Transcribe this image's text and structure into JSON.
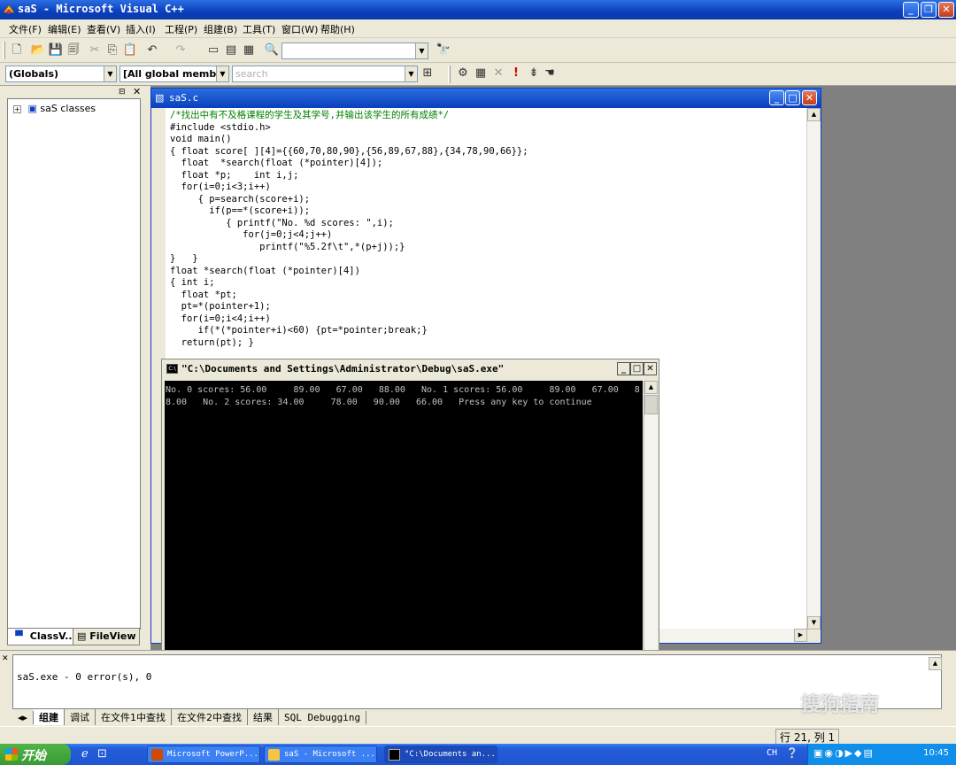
{
  "window": {
    "title": "saS - Microsoft Visual C++"
  },
  "menu": [
    "文件(F)",
    "编辑(E)",
    "查看(V)",
    "插入(I)",
    "工程(P)",
    "组建(B)",
    "工具(T)",
    "窗口(W)",
    "帮助(H)"
  ],
  "toolbar2": {
    "globals": "(Globals)",
    "members": "[All global members",
    "search_placeholder": "search"
  },
  "workspace": {
    "root": "saS classes",
    "tab_classview": "ClassV...",
    "tab_fileview": "FileView"
  },
  "editor": {
    "title": "saS.c",
    "code": "/*找出中有不及格课程的学生及其学号,并输出该学生的所有成绩*/\n#include <stdio.h>\nvoid main()\n{ float score[ ][4]={{60,70,80,90},{56,89,67,88},{34,78,90,66}};\n  float  *search(float (*pointer)[4]);\n  float *p;    int i,j;\n  for(i=0;i<3;i++)\n     { p=search(score+i);\n       if(p==*(score+i));\n          { printf(\"No. %d scores: \",i);\n             for(j=0;j<4;j++)\n                printf(\"%5.2f\\t\",*(p+j));}\n}   }\nfloat *search(float (*pointer)[4])\n{ int i;\n  float *pt;\n  pt=*(pointer+1);\n  for(i=0;i<4;i++)\n     if(*(*pointer+i)<60) {pt=*pointer;break;}\n  return(pt); }"
  },
  "console": {
    "title": "\"C:\\Documents and Settings\\Administrator\\Debug\\saS.exe\"",
    "output": "No. 0 scores: 56.00     89.00   67.00   88.00   No. 1 scores: 56.00     89.00   67.00   88.00   No. 2 scores: 34.00     78.00   90.00   66.00   Press any key to continue"
  },
  "output_panel": {
    "text": "saS.exe - 0 error(s), 0",
    "tabs": [
      "组建",
      "调试",
      "在文件1中查找",
      "在文件2中查找",
      "结果",
      "SQL Debugging"
    ]
  },
  "statusbar": {
    "position": "行 21, 列 1"
  },
  "taskbar": {
    "start": "开始",
    "tasks": [
      "Microsoft PowerP...",
      "saS - Microsoft ...",
      "\"C:\\Documents an..."
    ],
    "lang": "CH",
    "clock": "10:45"
  },
  "watermark": "搜狗指南",
  "colors": {
    "titlebar": "#0a3fbd",
    "console_bg": "#000000",
    "code_comment": "#008000"
  }
}
